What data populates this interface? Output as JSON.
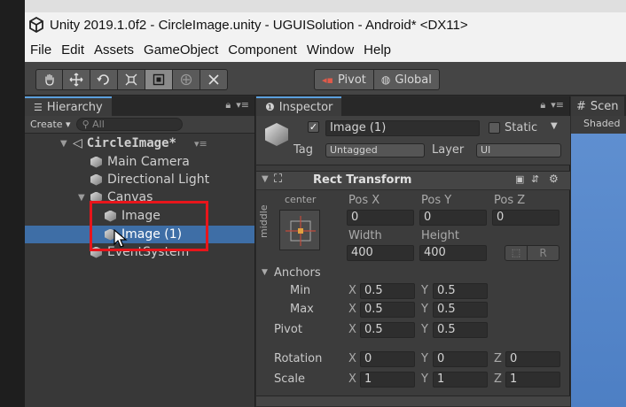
{
  "window": {
    "title": "Unity 2019.1.0f2 - CircleImage.unity - UGUISolution - Android* <DX11>"
  },
  "menu": [
    "File",
    "Edit",
    "Assets",
    "GameObject",
    "Component",
    "Window",
    "Help"
  ],
  "toolbar": {
    "pivot_label": "Pivot",
    "global_label": "Global"
  },
  "hierarchy": {
    "tab_label": "Hierarchy",
    "create_label": "Create",
    "search_placeholder": "All",
    "scene_name": "CircleImage*",
    "items": [
      "Main Camera",
      "Directional Light",
      "Canvas",
      "Image",
      "Image (1)",
      "EventSystem"
    ],
    "selected_item": "Image (1)"
  },
  "inspector": {
    "tab_label": "Inspector",
    "object_name": "Image (1)",
    "static_label": "Static",
    "tag_label": "Tag",
    "tag_value": "Untagged",
    "layer_label": "Layer",
    "layer_value": "UI",
    "rect_transform": {
      "title": "Rect Transform",
      "anchor_h": "center",
      "anchor_v": "middle",
      "pos_x_label": "Pos X",
      "pos_x": "0",
      "pos_y_label": "Pos Y",
      "pos_y": "0",
      "pos_z_label": "Pos Z",
      "pos_z": "0",
      "width_label": "Width",
      "width": "400",
      "height_label": "Height",
      "height": "400",
      "r_button": "R",
      "anchors_label": "Anchors",
      "min_label": "Min",
      "min_x": "0.5",
      "min_y": "0.5",
      "max_label": "Max",
      "max_x": "0.5",
      "max_y": "0.5",
      "pivot_label": "Pivot",
      "pivot_x": "0.5",
      "pivot_y": "0.5",
      "rotation_label": "Rotation",
      "rot_x": "0",
      "rot_y": "0",
      "rot_z": "0",
      "scale_label": "Scale",
      "scale_x": "1",
      "scale_y": "1",
      "scale_z": "1",
      "x_axis": "X",
      "y_axis": "Y",
      "z_axis": "Z"
    }
  },
  "scene": {
    "tab_label": "Scen",
    "shading": "Shaded"
  },
  "colors": {
    "selection": "#3e6ea6",
    "highlight_box": "#e8151b",
    "scene_sky": "#5f8fd0"
  }
}
